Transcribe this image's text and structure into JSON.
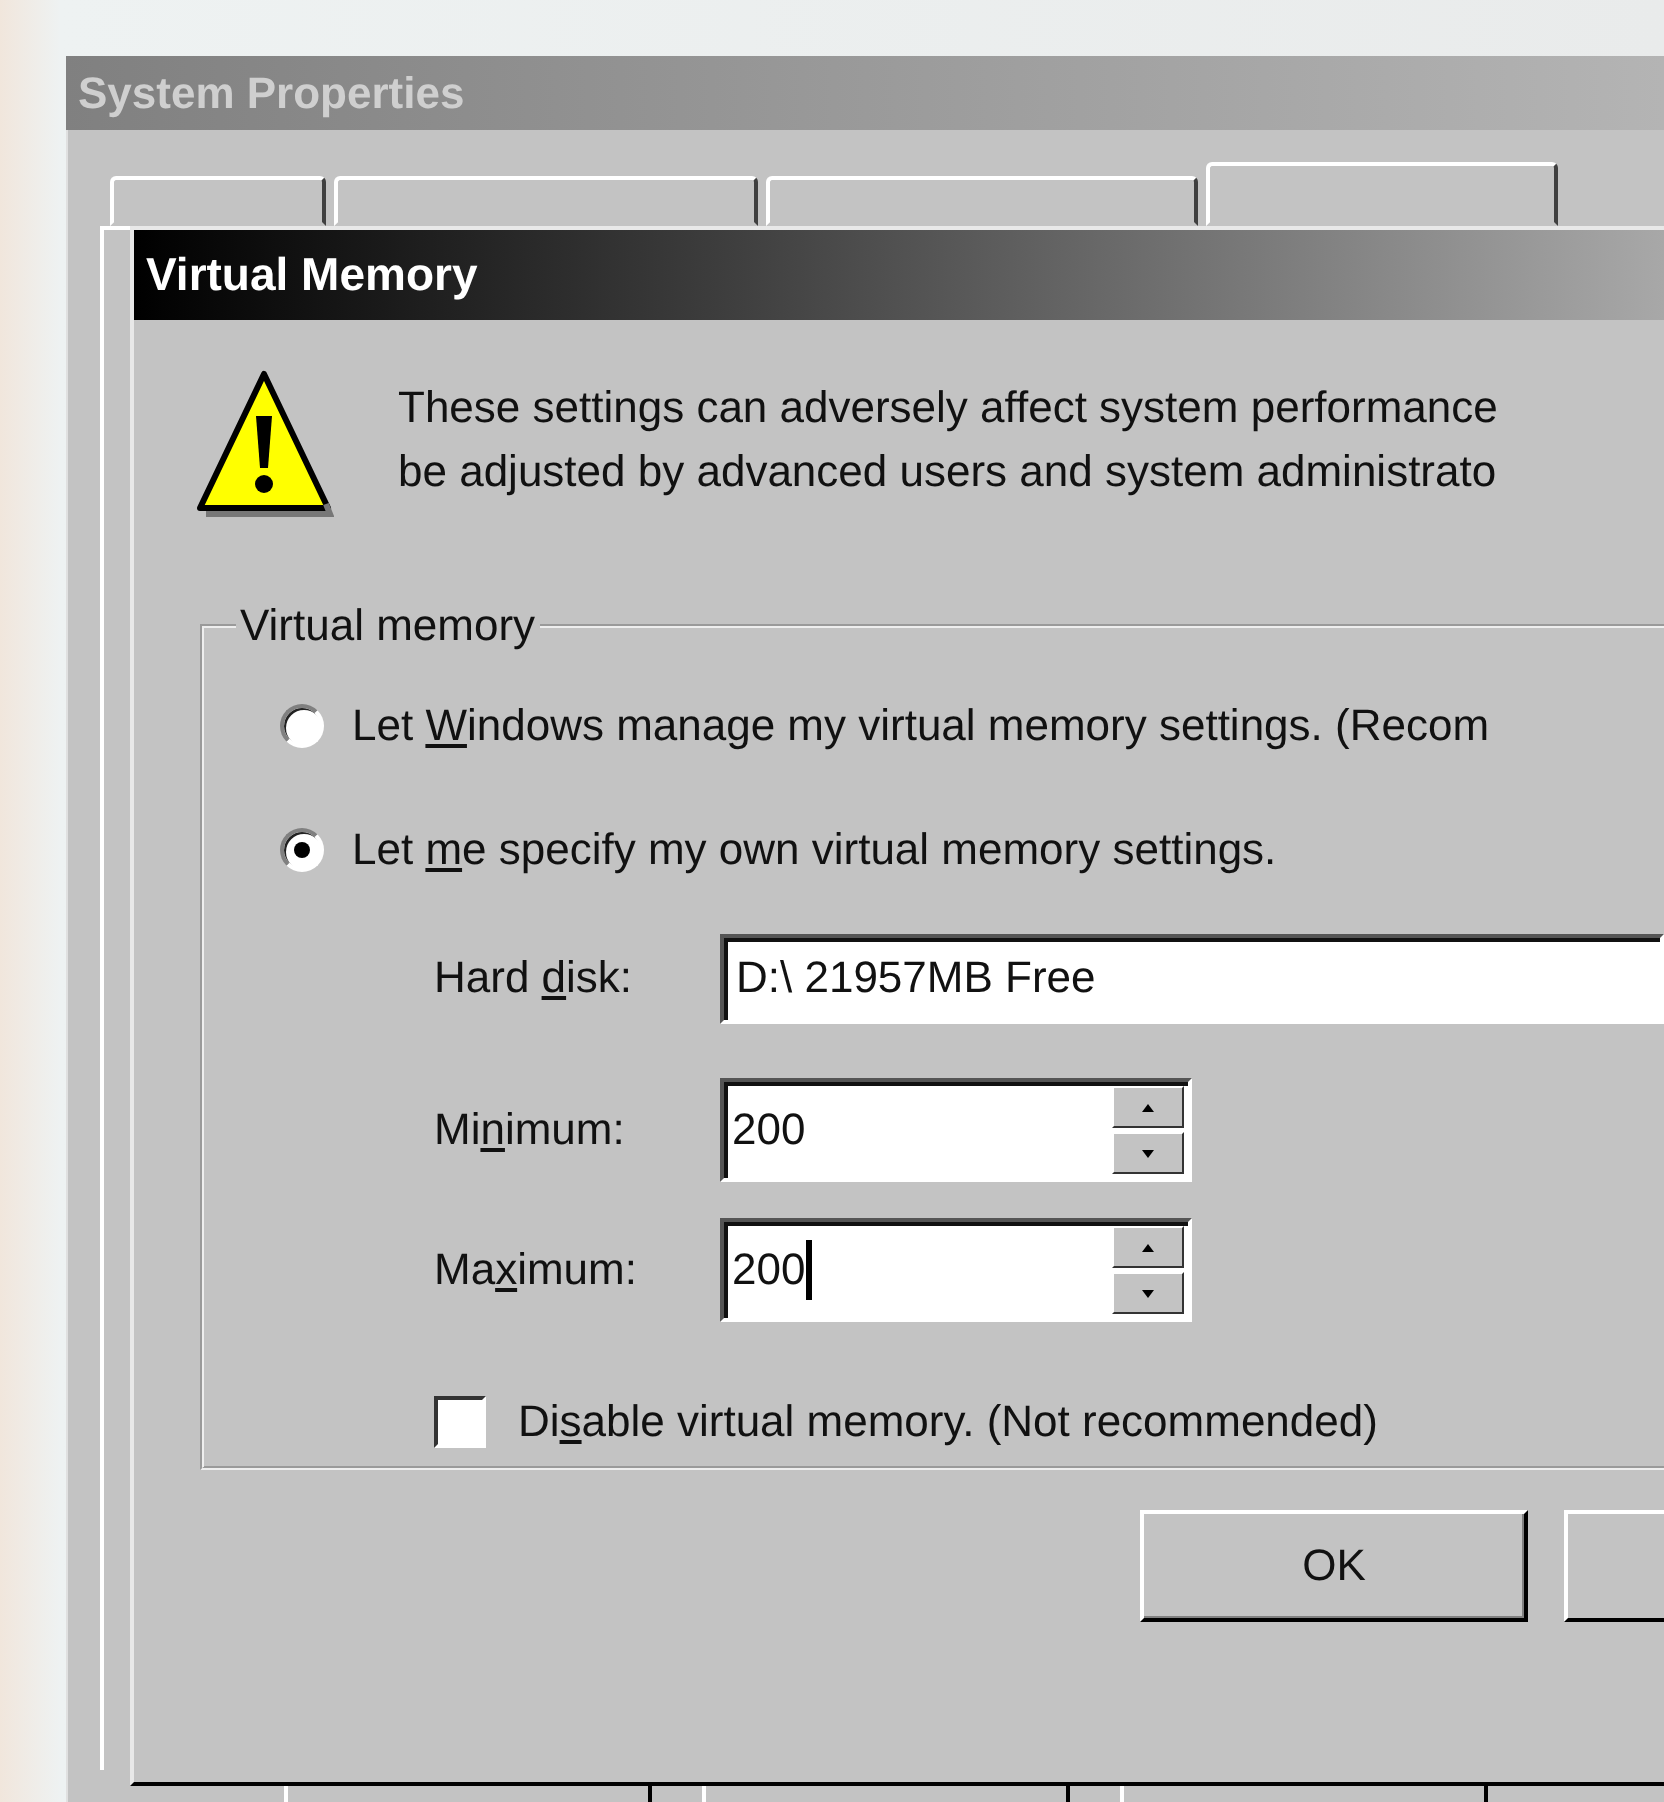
{
  "back_window": {
    "title": "System Properties",
    "tabs": [
      {
        "selected": false
      },
      {
        "selected": false
      },
      {
        "selected": false
      },
      {
        "selected": true
      }
    ]
  },
  "dialog": {
    "title": "Virtual Memory",
    "warning": [
      "These settings can adversely affect system performance",
      "be adjusted by advanced users and system administrato"
    ],
    "group": {
      "label": "Virtual memory",
      "options": [
        {
          "label": {
            "pre": "Let ",
            "key": "W",
            "post": "indows manage my virtual memory settings. (Recom"
          },
          "selected": false
        },
        {
          "label": {
            "pre": "Let ",
            "key": "m",
            "post": "e specify my own virtual memory settings."
          },
          "selected": true
        }
      ],
      "fields": [
        {
          "kind": "list",
          "label": {
            "pre": "Hard ",
            "key": "d",
            "post": "isk:"
          },
          "value": "D:\\ 21957MB Free",
          "focused": false
        },
        {
          "kind": "spin",
          "label": {
            "pre": "Mi",
            "key": "n",
            "post": "imum:"
          },
          "value": "200",
          "focused": false
        },
        {
          "kind": "spin",
          "label": {
            "pre": "Ma",
            "key": "x",
            "post": "imum:"
          },
          "value": "200",
          "focused": true
        }
      ],
      "disable": {
        "label": {
          "pre": "Di",
          "key": "s",
          "post": "able virtual memory. (Not recommended)"
        },
        "checked": false
      }
    },
    "ok_button": "OK"
  }
}
